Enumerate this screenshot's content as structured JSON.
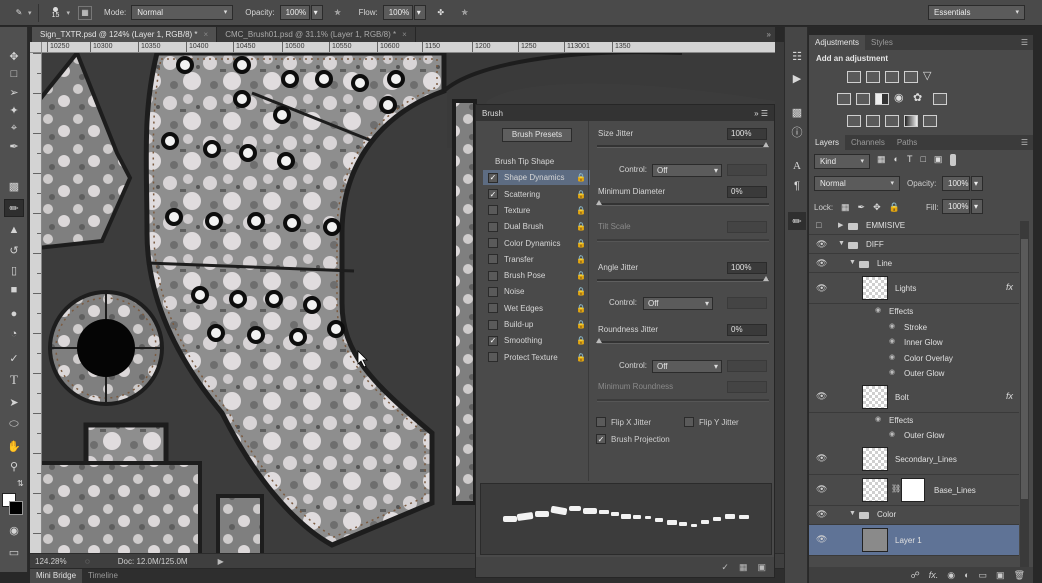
{
  "options_bar": {
    "brush_size": "15",
    "mode_label": "Mode:",
    "mode_value": "Normal",
    "opacity_label": "Opacity:",
    "opacity_value": "100%",
    "flow_label": "Flow:",
    "flow_value": "100%",
    "workspace": "Essentials"
  },
  "document_tabs": [
    {
      "label": "Sign_TXTR.psd @ 124% (Layer 1, RGB/8) *",
      "active": true
    },
    {
      "label": "CMC_Brush01.psd @ 31.1% (Layer 1, RGB/8) *",
      "active": false
    }
  ],
  "ruler_top_labels": [
    "10250",
    "10300",
    "10350",
    "10400",
    "10450",
    "10500",
    "10550",
    "10600",
    "1150",
    "1200",
    "1250",
    "113001",
    "1350"
  ],
  "status": {
    "zoom": "124.28%",
    "doc": "Doc: 12.0M/125.0M"
  },
  "bottom_tabs": [
    "Mini Bridge",
    "Timeline"
  ],
  "brush_panel": {
    "title": "Brush",
    "presets_button": "Brush Presets",
    "items": [
      {
        "label": "Brush Tip Shape",
        "checkbox": false,
        "checked": false,
        "selected": false
      },
      {
        "label": "Shape Dynamics",
        "checkbox": true,
        "checked": true,
        "selected": true
      },
      {
        "label": "Scattering",
        "checkbox": true,
        "checked": true,
        "selected": false
      },
      {
        "label": "Texture",
        "checkbox": true,
        "checked": false,
        "selected": false
      },
      {
        "label": "Dual Brush",
        "checkbox": true,
        "checked": false,
        "selected": false
      },
      {
        "label": "Color Dynamics",
        "checkbox": true,
        "checked": false,
        "selected": false
      },
      {
        "label": "Transfer",
        "checkbox": true,
        "checked": false,
        "selected": false
      },
      {
        "label": "Brush Pose",
        "checkbox": true,
        "checked": false,
        "selected": false
      },
      {
        "label": "Noise",
        "checkbox": true,
        "checked": false,
        "selected": false
      },
      {
        "label": "Wet Edges",
        "checkbox": true,
        "checked": false,
        "selected": false
      },
      {
        "label": "Build-up",
        "checkbox": true,
        "checked": false,
        "selected": false
      },
      {
        "label": "Smoothing",
        "checkbox": true,
        "checked": true,
        "selected": false
      },
      {
        "label": "Protect Texture",
        "checkbox": true,
        "checked": false,
        "selected": false
      }
    ],
    "settings": {
      "size_jitter_label": "Size Jitter",
      "size_jitter_value": "100%",
      "control_label": "Control:",
      "control_off": "Off",
      "min_diameter_label": "Minimum Diameter",
      "min_diameter_value": "0%",
      "tilt_scale_label": "Tilt Scale",
      "angle_jitter_label": "Angle Jitter",
      "angle_jitter_value": "100%",
      "roundness_jitter_label": "Roundness Jitter",
      "roundness_jitter_value": "0%",
      "min_roundness_label": "Minimum Roundness",
      "flip_x_label": "Flip X Jitter",
      "flip_y_label": "Flip Y Jitter",
      "brush_projection_label": "Brush Projection"
    }
  },
  "adjustments_panel": {
    "tabs": [
      "Adjustments",
      "Styles"
    ],
    "heading": "Add an adjustment"
  },
  "layers_panel": {
    "tabs": [
      "Layers",
      "Channels",
      "Paths"
    ],
    "kind_label": "Kind",
    "blend_mode": "Normal",
    "opacity_label": "Opacity:",
    "opacity_value": "100%",
    "lock_label": "Lock:",
    "fill_label": "Fill:",
    "fill_value": "100%",
    "rows": [
      {
        "type": "group",
        "label": "EMMISIVE",
        "indent": 0,
        "visible": false
      },
      {
        "type": "group",
        "label": "DIFF",
        "indent": 0,
        "visible": true
      },
      {
        "type": "group",
        "label": "Line",
        "indent": 1,
        "visible": true
      },
      {
        "type": "layer",
        "label": "Lights",
        "fx": true,
        "visible": true
      },
      {
        "type": "effects",
        "label": "Effects"
      },
      {
        "type": "effect",
        "label": "Stroke"
      },
      {
        "type": "effect",
        "label": "Inner Glow"
      },
      {
        "type": "effect",
        "label": "Color Overlay"
      },
      {
        "type": "effect",
        "label": "Outer Glow"
      },
      {
        "type": "layer",
        "label": "Bolt",
        "fx": true,
        "visible": true
      },
      {
        "type": "effects",
        "label": "Effects"
      },
      {
        "type": "effect",
        "label": "Outer Glow"
      },
      {
        "type": "layer",
        "label": "Secondary_Lines",
        "fx": false,
        "visible": true
      },
      {
        "type": "layer",
        "label": "Base_Lines",
        "fx": false,
        "visible": true
      },
      {
        "type": "group",
        "label": "Color",
        "indent": 1,
        "visible": true
      },
      {
        "type": "layer",
        "label": "Layer 1",
        "fx": false,
        "visible": true,
        "selected": true
      }
    ]
  }
}
